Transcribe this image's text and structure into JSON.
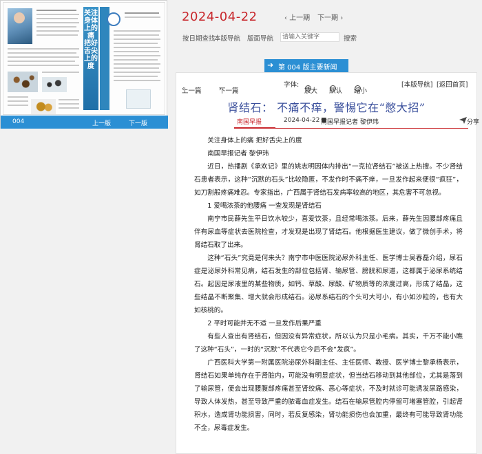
{
  "thumbnail": {
    "page_number": "004",
    "prev_label": "上一版",
    "next_label": "下一版",
    "band_text": "关注身体上的痛 把好舌尖上的度"
  },
  "header": {
    "date": "2024-04-22",
    "prev_label": "上一期",
    "next_label": "下一期",
    "date_search_label": "按日期查找",
    "section_nav_label": "本版导航",
    "page_nav_label": "版面导航",
    "search_placeholder": "请输入关键字",
    "search_button": "搜索"
  },
  "section_tag": {
    "label": "第 004 版主要新闻"
  },
  "article_toolbar": {
    "prev": "上一篇",
    "next": "下一篇",
    "font_label": "字体:",
    "zoom_in": "放大",
    "default": "默认",
    "zoom_out": "缩小",
    "section_nav": "[本版导航]",
    "back_home": "[返回首页]"
  },
  "article": {
    "title": "肾结石：  不痛不痒，警惕它在“憋大招”",
    "source": "南国早报",
    "date": "2024-04-22",
    "author": "南国早报记者  黎伊玮",
    "share": "分享",
    "paragraphs": [
      "关注身体上的痛 把好舌尖上的度",
      "南国早报记者 黎伊玮",
      "近日，热播剧《承欢记》里的姚志明因体内排出“一克拉肾结石”被送上热搜。不少肾结石患者表示，这种“沉默的石头”比较隐匿，不发作时不痛不痒，一旦发作起来便很“疯狂”，如刀割般疼痛难忍。专家指出，广西属于肾结石发病率较高的地区，其危害不可忽视。",
      "1 爱喝浓茶的他腰痛  一查发现是肾结石",
      "南宁市民薛先生平日饮水较少，喜爱饮茶，且经常喝浓茶。后来，薛先生因腰部疼痛且伴有尿血等症状去医院检查，才发现是出现了肾结石。他根据医生建议，做了微创手术，将肾结石取了出来。",
      "这种“石头”究竟是何来头？南宁市中医医院泌尿外科主任、医学博士吴春磊介绍，尿石症是泌尿外科常见病，结石发生的部位包括肾、输尿管、膀胱和尿道，这都属于泌尿系统结石。起因是尿液里的某些物质，如钙、草酸、尿酸、矿物质等的浓度过高，形成了结晶，这些结晶不断聚集、增大就会形成结石。泌尿系结石的个头可大可小，有小如沙粒的，也有大如核桃的。",
      "2 平时可能并无不适  一旦发作后果严重",
      "有些人查出有肾结石，但因没有异常症状，所以认为只是小毛病。其实，千万不能小瞧了这种“石头”，一时的“沉默”不代表它今后不会“发疯”。",
      "广西医科大学第一附属医院泌尿外科副主任、主任医师、教授、医学博士黎承杨表示，肾结石如果单纯存在于肾脏内，可能没有明显症状，但当结石移动到其他部位，尤其是落到了输尿管，便会出现腰腹部疼痛甚至肾绞痛、恶心等症状，不及时就诊可能诱发尿路感染，导致人体发热，甚至导致严重的脓毒血症发生。结石在输尿管腔内停留可堵塞管腔，引起肾积水，造成肾功能损害，同时，若反复感染，肾功能损伤也会加重，最终有可能导致肾功能不全，尿毒症发生。"
    ]
  }
}
